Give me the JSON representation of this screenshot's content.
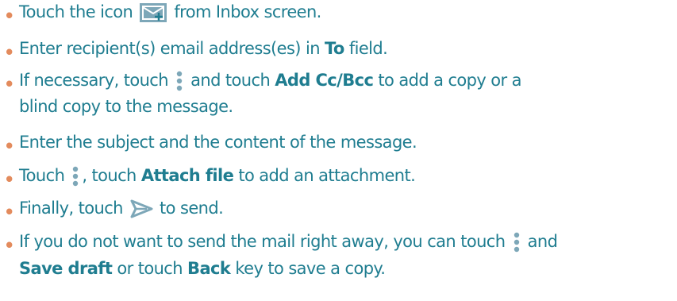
{
  "bullet_glyph": "•",
  "colors": {
    "text": "#1f7d90",
    "bullet": "#e38b5d",
    "icon_fill": "#7da7b8"
  },
  "steps": [
    {
      "parts": [
        "Touch the icon",
        "from Inbox screen."
      ],
      "icons": [
        "compose-icon"
      ]
    },
    {
      "parts": [
        "Enter recipient(s) email address(es) in",
        "To",
        "field."
      ]
    },
    {
      "line1_parts": [
        "If necessary, touch",
        "and touch",
        "Add Cc/Bcc",
        "to add a copy or a"
      ],
      "line2": "blind copy to the message.",
      "icons": [
        "more-options-icon"
      ]
    },
    {
      "parts": [
        "Enter the subject and the content of the message."
      ]
    },
    {
      "parts": [
        "Touch",
        ", touch",
        "Attach file",
        "to add an attachment."
      ],
      "icons": [
        "more-options-icon"
      ]
    },
    {
      "parts": [
        "Finally, touch",
        "to send."
      ],
      "icons": [
        "send-icon"
      ]
    },
    {
      "line1_parts": [
        "If you do not want to send the mail right away, you can touch",
        "and"
      ],
      "line2_parts": [
        "Save draft",
        "or touch",
        "Back",
        "key to save a copy."
      ],
      "icons": [
        "more-options-icon"
      ]
    }
  ]
}
